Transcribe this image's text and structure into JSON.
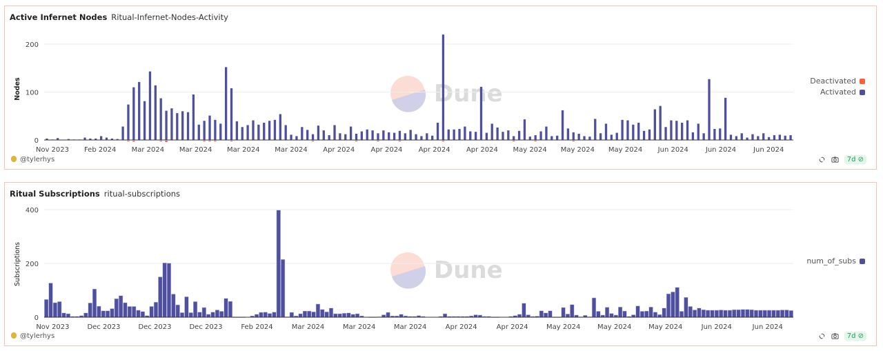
{
  "panels": [
    {
      "title": "Active Infernet Nodes",
      "subtitle": "Ritual-Infernet-Nodes-Activity",
      "author": "@tylerhys",
      "badge": "7d",
      "watermark": "Dune"
    },
    {
      "title": "Ritual Subscriptions",
      "subtitle": "ritual-subscriptions",
      "author": "@tylerhys",
      "badge": "7d",
      "watermark": "Dune"
    }
  ],
  "chart_data": [
    {
      "type": "bar",
      "title": "Active Infernet Nodes",
      "xlabel": "",
      "ylabel": "Nodes",
      "ylim": [
        -10,
        220
      ],
      "yticks": [
        0,
        100,
        200
      ],
      "grid": true,
      "legend": "right",
      "x_tick_labels": [
        "Nov 2023",
        "Feb 2024",
        "Mar 2024",
        "Mar 2024",
        "Mar 2024",
        "Mar 2024",
        "Apr 2024",
        "Apr 2024",
        "Apr 2024",
        "Apr 2024",
        "May 2024",
        "May 2024",
        "May 2024",
        "Jun 2024",
        "Jun 2024",
        "Jun 2024"
      ],
      "series": [
        {
          "name": "Deactivated",
          "color": "#f4623a",
          "values": [
            0,
            0,
            0,
            0,
            0,
            0,
            0,
            0,
            0,
            0,
            0,
            0,
            0,
            0,
            0,
            -1,
            -2,
            0,
            0,
            0,
            0,
            -1,
            -3,
            0,
            0,
            0,
            0,
            0,
            0,
            -1,
            -1,
            -1,
            0,
            0,
            -1,
            0,
            0,
            0,
            0,
            0,
            0,
            0,
            0,
            0,
            0,
            0,
            0,
            0,
            0,
            -1,
            0,
            0,
            0,
            0,
            0,
            0,
            0,
            -1,
            0,
            0,
            0,
            -1,
            0,
            0,
            0,
            -1,
            0,
            0,
            0,
            0,
            0,
            0,
            0,
            -1,
            0,
            0,
            0,
            0,
            0,
            0,
            0,
            0,
            0,
            0,
            0,
            0,
            -1,
            0,
            0,
            0,
            -1,
            0,
            0,
            0,
            0,
            0,
            0,
            -1,
            0,
            0,
            0,
            0,
            0,
            0,
            0,
            0,
            0,
            0,
            0,
            0
          ]
        },
        {
          "name": "Activated",
          "color": "#4f4fa0",
          "values": [
            3,
            1,
            4,
            0,
            2,
            1,
            1,
            5,
            3,
            3,
            8,
            5,
            3,
            2,
            28,
            74,
            110,
            121,
            81,
            143,
            114,
            87,
            61,
            66,
            56,
            60,
            58,
            95,
            32,
            40,
            51,
            42,
            34,
            152,
            108,
            39,
            27,
            31,
            41,
            32,
            36,
            40,
            42,
            54,
            31,
            11,
            8,
            27,
            21,
            12,
            30,
            20,
            10,
            31,
            14,
            12,
            28,
            13,
            18,
            22,
            20,
            14,
            20,
            16,
            15,
            19,
            14,
            21,
            12,
            8,
            14,
            9,
            36,
            220,
            22,
            22,
            23,
            28,
            18,
            17,
            111,
            15,
            34,
            26,
            17,
            20,
            8,
            19,
            43,
            7,
            10,
            18,
            28,
            8,
            9,
            62,
            24,
            16,
            13,
            8,
            7,
            44,
            14,
            34,
            11,
            15,
            42,
            41,
            32,
            36,
            19,
            22,
            64,
            71,
            27,
            41,
            40,
            36,
            41,
            16,
            34,
            14,
            127,
            23,
            24,
            88,
            11,
            8,
            14,
            5,
            12,
            8,
            14,
            6,
            10,
            11,
            9,
            10
          ]
        }
      ]
    },
    {
      "type": "bar",
      "title": "Ritual Subscriptions",
      "xlabel": "",
      "ylabel": "Subscriptions",
      "ylim": [
        0,
        400
      ],
      "yticks": [
        0,
        200,
        400
      ],
      "grid": true,
      "legend": "right",
      "x_tick_labels": [
        "Nov 2023",
        "Dec 2023",
        "Dec 2023",
        "Dec 2023",
        "Feb 2024",
        "Mar 2024",
        "Mar 2024",
        "Mar 2024",
        "Apr 2024",
        "Apr 2024",
        "May 2024",
        "May 2024",
        "May 2024",
        "Jun 2024",
        "Jun 2024"
      ],
      "series": [
        {
          "name": "num_of_subs",
          "color": "#4f4fa0",
          "values": [
            66,
            127,
            54,
            58,
            16,
            13,
            3,
            3,
            6,
            16,
            53,
            105,
            41,
            24,
            24,
            32,
            69,
            80,
            54,
            40,
            40,
            26,
            21,
            6,
            40,
            56,
            150,
            202,
            201,
            86,
            46,
            17,
            76,
            17,
            58,
            19,
            36,
            11,
            19,
            27,
            22,
            70,
            59,
            1,
            1,
            1,
            0,
            5,
            11,
            18,
            19,
            14,
            19,
            398,
            215,
            2,
            18,
            5,
            13,
            23,
            23,
            20,
            49,
            29,
            20,
            34,
            13,
            13,
            15,
            16,
            11,
            13,
            5,
            0,
            1,
            1,
            2,
            9,
            18,
            5,
            5,
            11,
            5,
            3,
            3,
            6,
            3,
            0,
            0,
            0,
            3,
            13,
            3,
            3,
            3,
            3,
            3,
            5,
            9,
            8,
            3,
            3,
            1,
            1,
            0,
            0,
            3,
            6,
            11,
            52,
            9,
            3,
            4,
            24,
            16,
            24,
            1,
            1,
            36,
            12,
            47,
            8,
            2,
            7,
            2,
            72,
            22,
            8,
            37,
            14,
            8,
            38,
            23,
            3,
            9,
            42,
            22,
            23,
            38,
            19,
            10,
            34,
            87,
            94,
            111,
            22,
            74,
            40,
            27,
            34,
            28,
            26,
            26,
            26,
            27,
            26,
            26,
            28,
            28,
            29,
            29,
            28,
            26,
            26,
            26,
            26,
            26,
            26,
            27,
            27,
            25
          ]
        }
      ]
    }
  ]
}
